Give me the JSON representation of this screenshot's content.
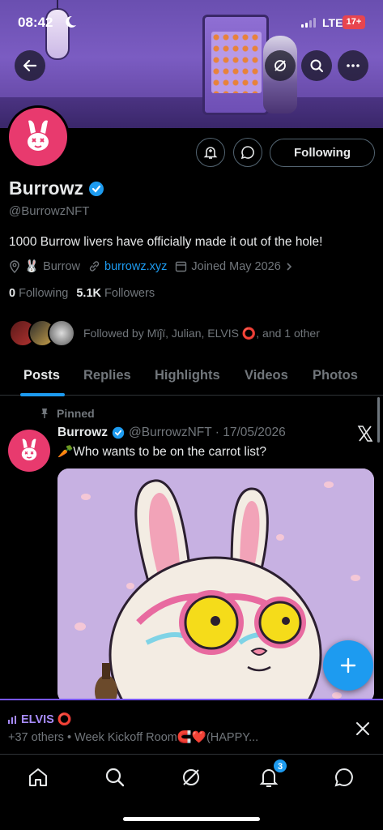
{
  "status_bar": {
    "time": "08:42",
    "network": "LTE",
    "battery": "17+"
  },
  "profile": {
    "name": "Burrowz",
    "handle": "@BurrowzNFT",
    "bio": "1000 Burrow livers have officially made it out of the hole!",
    "location": "Burrow",
    "website": "burrowz.xyz",
    "joined": "Joined May 2026",
    "following_count": "0",
    "following_label": "Following",
    "followers_count": "5.1K",
    "followers_label": "Followers",
    "followed_by": "Followed by Μïĵï, Julian, ELVIS ⭕, and 1 other",
    "follow_button": "Following"
  },
  "tabs": [
    "Posts",
    "Replies",
    "Highlights",
    "Videos",
    "Photos"
  ],
  "active_tab": "Posts",
  "pinned_post": {
    "pinned_label": "Pinned",
    "author": "Burrowz",
    "handle_date": "@BurrowzNFT · 17/05/2026",
    "text": "🥕Who wants to be on the carrot list?"
  },
  "space": {
    "host": "ELVIS ⭕",
    "description": "+37 others • Week Kickoff Room🧲❤️(HAPPY..."
  },
  "navbar": {
    "notifications_badge": "3"
  },
  "colors": {
    "accent": "#1d9bf0",
    "space": "#a78bfa",
    "avatar": "#e83a6e"
  }
}
